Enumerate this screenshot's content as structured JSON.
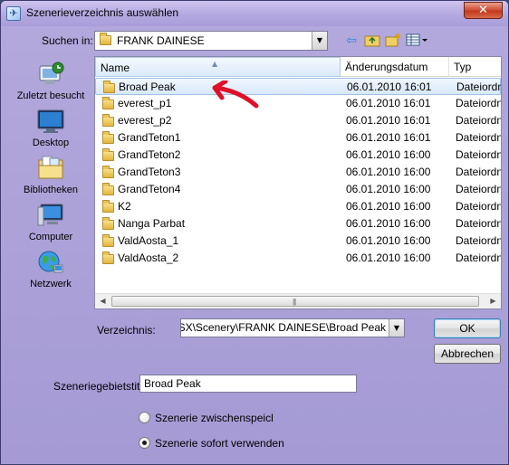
{
  "window": {
    "title": "Szenerieverzeichnis auswählen",
    "close_glyph": "✕"
  },
  "lookin": {
    "label": "Suchen in:",
    "value": "FRANK DAINESE"
  },
  "toolbar": {
    "back_icon": "back-arrow-icon",
    "up_icon": "up-folder-icon",
    "new_folder_icon": "new-folder-icon",
    "view_icon": "view-menu-icon"
  },
  "places": [
    {
      "label": "Zuletzt besucht",
      "icon": "recent-places-icon"
    },
    {
      "label": "Desktop",
      "icon": "desktop-icon"
    },
    {
      "label": "Bibliotheken",
      "icon": "libraries-icon"
    },
    {
      "label": "Computer",
      "icon": "computer-icon"
    },
    {
      "label": "Netzwerk",
      "icon": "network-icon"
    }
  ],
  "columns": {
    "name": "Name",
    "date": "Änderungsdatum",
    "type": "Typ"
  },
  "files": [
    {
      "name": "Broad Peak",
      "date": "06.01.2010 16:01",
      "type": "Dateiordn",
      "selected": true
    },
    {
      "name": "everest_p1",
      "date": "06.01.2010 16:01",
      "type": "Dateiordn"
    },
    {
      "name": "everest_p2",
      "date": "06.01.2010 16:01",
      "type": "Dateiordn"
    },
    {
      "name": "GrandTeton1",
      "date": "06.01.2010 16:01",
      "type": "Dateiordn"
    },
    {
      "name": "GrandTeton2",
      "date": "06.01.2010 16:00",
      "type": "Dateiordn"
    },
    {
      "name": "GrandTeton3",
      "date": "06.01.2010 16:00",
      "type": "Dateiordn"
    },
    {
      "name": "GrandTeton4",
      "date": "06.01.2010 16:00",
      "type": "Dateiordn"
    },
    {
      "name": "K2",
      "date": "06.01.2010 16:00",
      "type": "Dateiordn"
    },
    {
      "name": "Nanga Parbat",
      "date": "06.01.2010 16:00",
      "type": "Dateiordn"
    },
    {
      "name": "ValdAosta_1",
      "date": "06.01.2010 16:00",
      "type": "Dateiordn"
    },
    {
      "name": "ValdAosta_2",
      "date": "06.01.2010 16:00",
      "type": "Dateiordn"
    }
  ],
  "directory": {
    "label": "Verzeichnis:",
    "value": "\\FSX\\Scenery\\FRANK DAINESE\\Broad Peak"
  },
  "buttons": {
    "ok": "OK",
    "cancel": "Abbrechen"
  },
  "area_title": {
    "label": "Szeneriegebietstitel:",
    "value": "Broad Peak"
  },
  "options": [
    {
      "label": "Szenerie zwischenspeicl",
      "checked": false
    },
    {
      "label": "Szenerie sofort verwenden",
      "checked": true
    }
  ],
  "colors": {
    "window_bg": "#a99ed9",
    "selection": "#d8e8fb",
    "annotation_arrow": "#e0102a"
  }
}
